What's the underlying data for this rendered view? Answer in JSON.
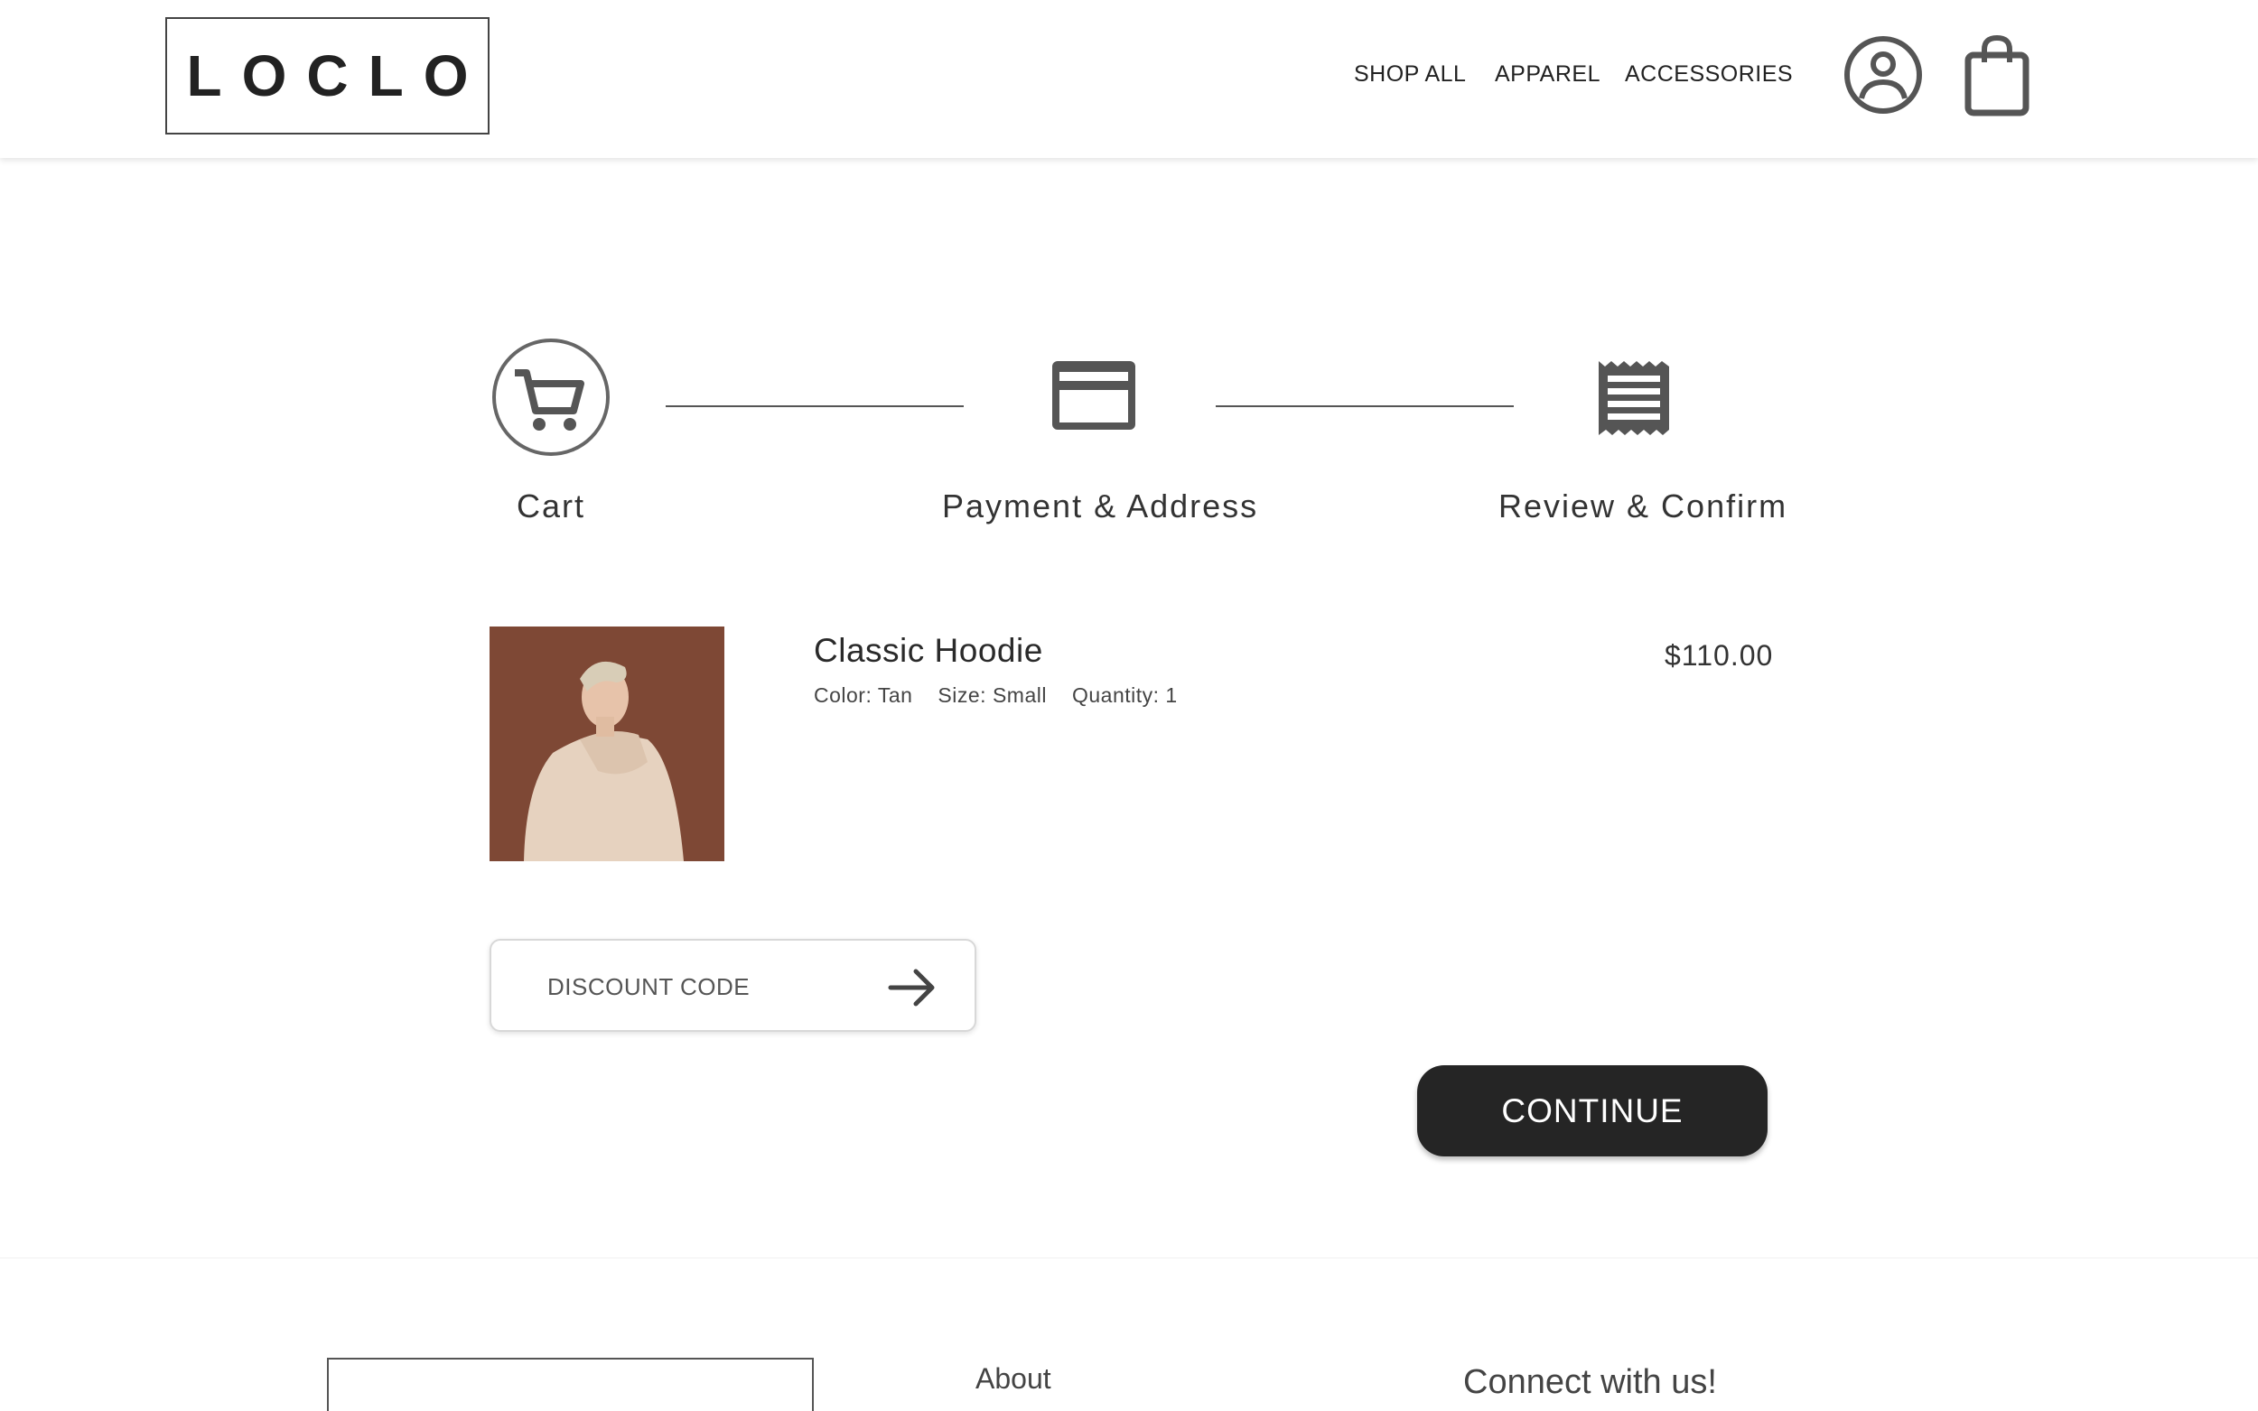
{
  "header": {
    "logo": "LOCLO",
    "nav": [
      "SHOP ALL",
      "APPAREL",
      "ACCESSORIES"
    ],
    "icons": [
      "account-icon",
      "shopping-bag-icon"
    ]
  },
  "stepper": {
    "steps": [
      {
        "label": "Cart",
        "icon": "cart-icon",
        "active": true
      },
      {
        "label": "Payment & Address",
        "icon": "credit-card-icon",
        "active": false
      },
      {
        "label": "Review & Confirm",
        "icon": "receipt-icon",
        "active": false
      }
    ]
  },
  "product": {
    "name": "Classic Hoodie",
    "color": "Color: Tan",
    "size": "Size: Small",
    "quantity": "Quantity: 1",
    "price": "$110.00"
  },
  "discount": {
    "placeholder": "DISCOUNT CODE"
  },
  "actions": {
    "continue_label": "CONTINUE"
  },
  "footer": {
    "about": "About",
    "connect": "Connect with us!"
  },
  "colors": {
    "primary_button": "#252525",
    "icon": "#555555",
    "text": "#2b2b2b"
  }
}
